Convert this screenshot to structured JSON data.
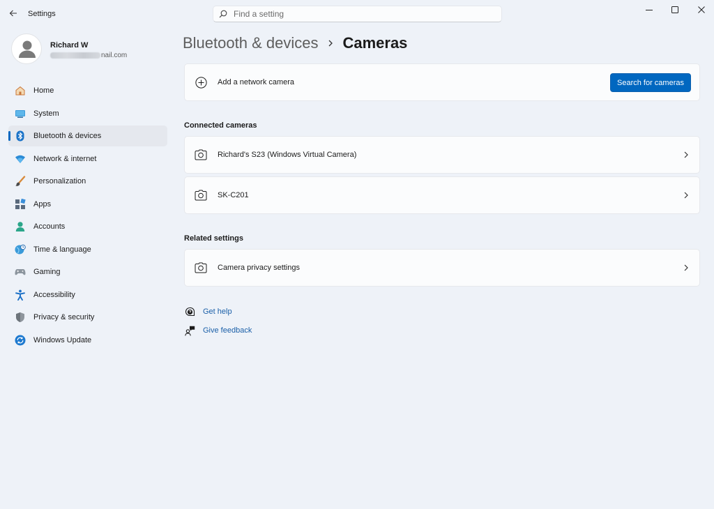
{
  "titlebar": {
    "app_title": "Settings",
    "search_placeholder": "Find a setting"
  },
  "profile": {
    "name": "Richard W",
    "email_visible": "nail.com"
  },
  "sidebar": {
    "items": [
      {
        "label": "Home",
        "icon": "home-icon"
      },
      {
        "label": "System",
        "icon": "system-icon"
      },
      {
        "label": "Bluetooth & devices",
        "icon": "bluetooth-icon",
        "active": true
      },
      {
        "label": "Network & internet",
        "icon": "wifi-icon"
      },
      {
        "label": "Personalization",
        "icon": "brush-icon"
      },
      {
        "label": "Apps",
        "icon": "apps-icon"
      },
      {
        "label": "Accounts",
        "icon": "accounts-icon"
      },
      {
        "label": "Time & language",
        "icon": "globe-clock-icon"
      },
      {
        "label": "Gaming",
        "icon": "gamepad-icon"
      },
      {
        "label": "Accessibility",
        "icon": "accessibility-icon"
      },
      {
        "label": "Privacy & security",
        "icon": "shield-icon"
      },
      {
        "label": "Windows Update",
        "icon": "update-icon"
      }
    ]
  },
  "main": {
    "breadcrumb_parent": "Bluetooth & devices",
    "breadcrumb_current": "Cameras",
    "add_camera": {
      "label": "Add a network camera",
      "button": "Search for cameras"
    },
    "connected_title": "Connected cameras",
    "cameras": [
      {
        "label": "Richard's S23 (Windows Virtual Camera)"
      },
      {
        "label": "SK-C201"
      }
    ],
    "related_title": "Related settings",
    "related": [
      {
        "label": "Camera privacy settings"
      }
    ],
    "help": {
      "get_help": "Get help",
      "give_feedback": "Give feedback"
    }
  },
  "colors": {
    "accent": "#0067c0",
    "background": "#eef2f8",
    "card": "#fbfcfd",
    "link": "#1a5fa8"
  }
}
